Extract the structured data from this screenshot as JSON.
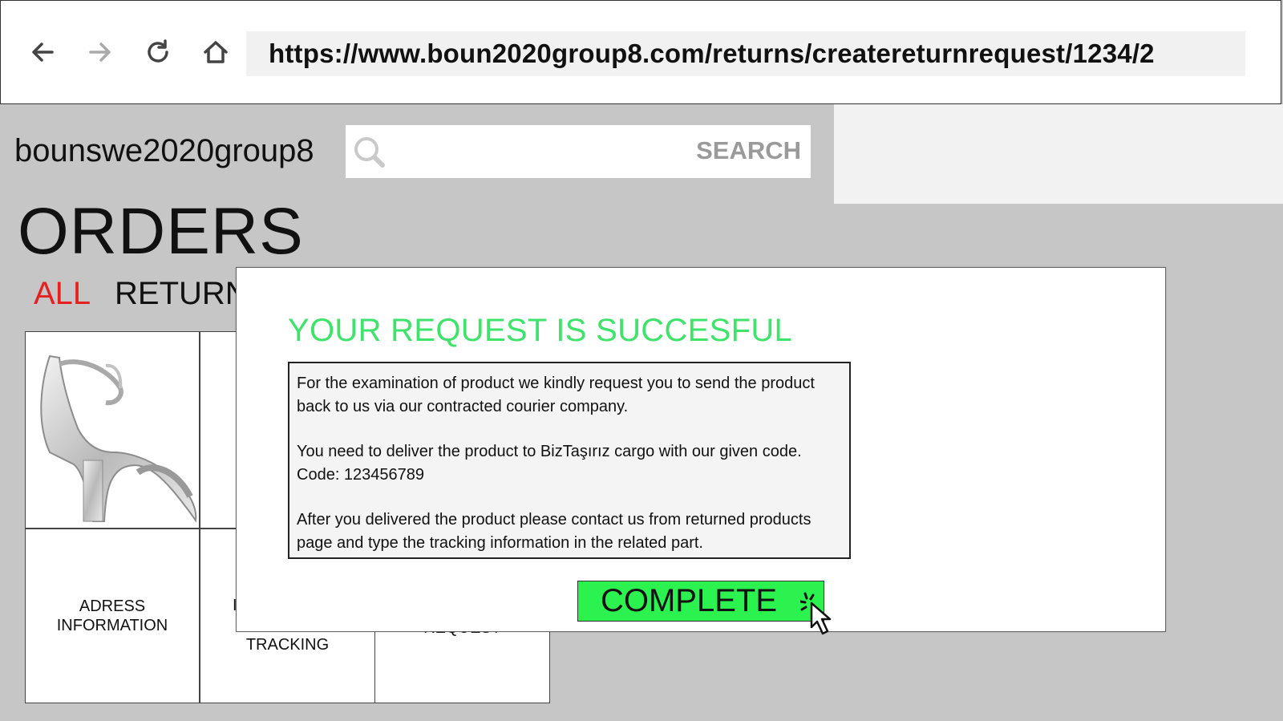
{
  "browser": {
    "url": "https://www.boun2020group8.com/returns/createreturnrequest/1234/2",
    "icons": [
      "back-arrow-icon",
      "forward-arrow-icon",
      "reload-icon",
      "home-icon"
    ]
  },
  "header": {
    "site_name": "bounswe2020group8",
    "search_label": "SEARCH"
  },
  "page": {
    "title": "ORDERS",
    "tabs": [
      {
        "label": "ALL",
        "color": "#e52020"
      },
      {
        "label": "RETURN"
      }
    ]
  },
  "order_cells": {
    "address_line1": "ADRESS",
    "address_line2": "INFORMATION",
    "tracking_partial": "I",
    "tracking_label": "TRACKING",
    "request_partial": "REQUEST"
  },
  "modal": {
    "title": "YOUR REQUEST IS SUCCESFUL",
    "title_color": "#3fe26a",
    "paragraph1": "For the examination of product we kindly request you to send the product back to us via our contracted courier company.",
    "paragraph2_line1": "You need to deliver the product to BizTaşırız cargo with our given code.",
    "paragraph2_line2": "Code: 123456789",
    "paragraph3": "After you delivered the product please contact us from returned products page and type the tracking information in the related part.",
    "button_label": "COMPLETE",
    "button_color": "#2cf24f"
  }
}
